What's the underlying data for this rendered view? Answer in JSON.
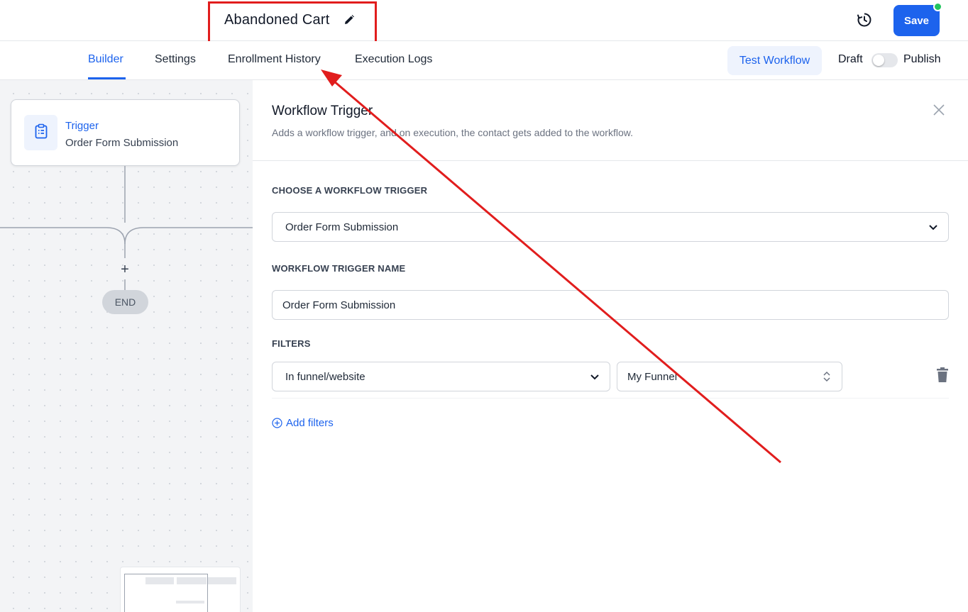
{
  "header": {
    "workflow_name": "Abandoned Cart",
    "save_label": "Save",
    "icons": {
      "edit": "pencil-icon",
      "history": "history-icon"
    },
    "status_dot_color": "#22c55e"
  },
  "tabs": [
    {
      "label": "Builder",
      "active": true
    },
    {
      "label": "Settings",
      "active": false
    },
    {
      "label": "Enrollment History",
      "active": false
    },
    {
      "label": "Execution Logs",
      "active": false
    }
  ],
  "toolbar": {
    "test_label": "Test Workflow",
    "draft_label": "Draft",
    "publish_label": "Publish",
    "publish_on": false
  },
  "canvas": {
    "trigger_node": {
      "label": "Trigger",
      "subtitle": "Order Form Submission",
      "icon": "clipboard-icon"
    },
    "add_step_symbol": "+",
    "end_label": "END"
  },
  "panel": {
    "title": "Workflow Trigger",
    "description": "Adds a workflow trigger, and on execution, the contact gets added to the workflow.",
    "choose_trigger": {
      "label": "CHOOSE A WORKFLOW TRIGGER",
      "selected": "Order Form Submission"
    },
    "trigger_name": {
      "label": "WORKFLOW TRIGGER NAME",
      "value": "Order Form Submission"
    },
    "filters": {
      "label": "FILTERS",
      "items": [
        {
          "field": "In funnel/website",
          "value": "My Funnel"
        }
      ],
      "add_label": "Add filters"
    }
  },
  "colors": {
    "accent": "#1d63ed",
    "annotation": "#e11d1d"
  }
}
